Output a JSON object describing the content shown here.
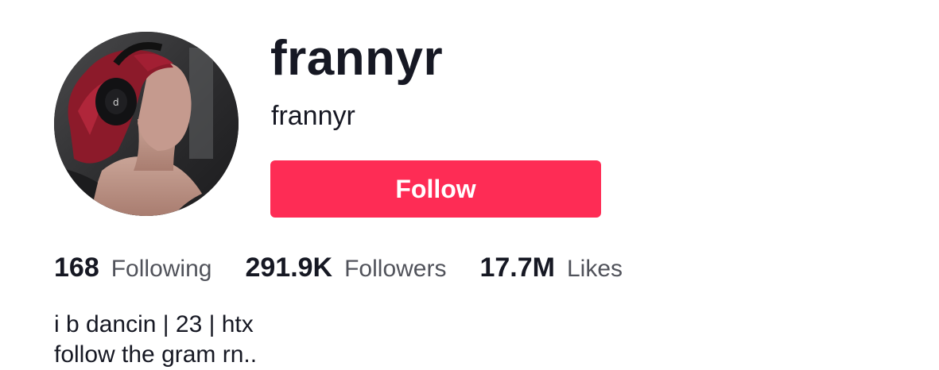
{
  "profile": {
    "display_name": "frannyr",
    "username": "frannyr",
    "avatar_icon": "profile-photo"
  },
  "actions": {
    "follow_label": "Follow",
    "follow_color": "#fe2c55"
  },
  "stats": [
    {
      "count": "168",
      "label": "Following"
    },
    {
      "count": "291.9K",
      "label": "Followers"
    },
    {
      "count": "17.7M",
      "label": "Likes"
    }
  ],
  "bio": {
    "lines": [
      "i b dancin | 23 | htx",
      "follow the gram rn.."
    ]
  }
}
